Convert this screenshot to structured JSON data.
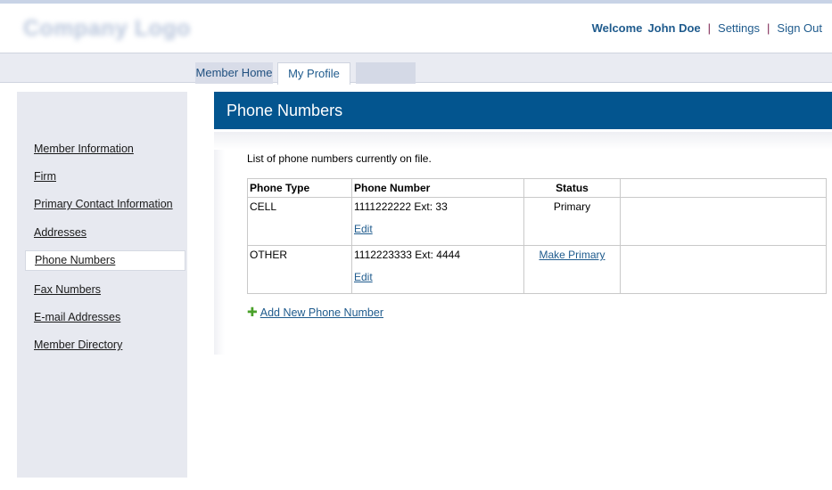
{
  "header": {
    "logo_text": "Company Logo",
    "welcome": "Welcome",
    "user_name": "John Doe",
    "sep1": "|",
    "settings": "Settings",
    "sep2": "|",
    "sign_out": "Sign Out"
  },
  "tabs": [
    {
      "label": "Member Home"
    },
    {
      "label": "My Profile",
      "active": true
    },
    {
      "label": ""
    }
  ],
  "sidebar": {
    "items": [
      {
        "label": "Member Information"
      },
      {
        "label": "Firm"
      },
      {
        "label": "Primary Contact Information"
      },
      {
        "label": "Addresses"
      },
      {
        "label": "Phone Numbers",
        "active": true
      },
      {
        "label": "Fax Numbers"
      },
      {
        "label": "E-mail Addresses"
      },
      {
        "label": "Member Directory"
      }
    ]
  },
  "main": {
    "title": "Phone Numbers",
    "intro": "List of phone numbers currently on file.",
    "table": {
      "headers": [
        "Phone Type",
        "Phone Number",
        "Status",
        ""
      ],
      "rows": [
        {
          "type": "CELL",
          "number": "1111222222 Ext: 33",
          "edit": "Edit",
          "status": "Primary",
          "status_is_link": false
        },
        {
          "type": "OTHER",
          "number": "1112223333 Ext: 4444",
          "edit": "Edit",
          "status": "Make Primary",
          "status_is_link": true
        }
      ]
    },
    "add_new_label": "Add New Phone Number"
  },
  "colors": {
    "header_blue": "#03558f",
    "link_blue": "#1f5b8d",
    "add_icon_green": "#4aa12a"
  }
}
